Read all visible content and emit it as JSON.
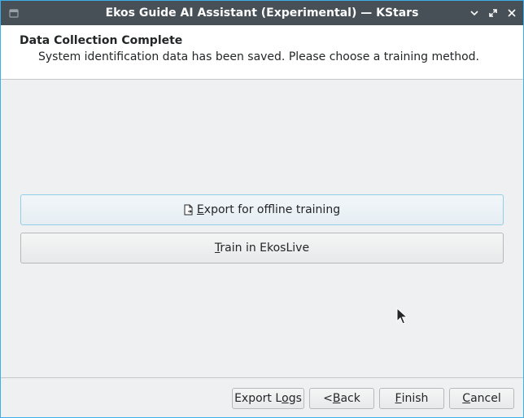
{
  "window": {
    "title": "Ekos Guide AI Assistant (Experimental) — KStars",
    "icons": {
      "app": "kstars-app-icon",
      "minimize": "chevron-down-icon",
      "maximize": "maximize-icon",
      "close": "close-icon"
    }
  },
  "header": {
    "title": "Data Collection Complete",
    "subtitle": "System identification data has been saved. Please choose a training method."
  },
  "options": [
    {
      "mnemonic": "E",
      "rest": "xport for offline training",
      "icon": "document-export-icon",
      "focused": true
    },
    {
      "mnemonic": "T",
      "rest": "rain in EkosLive",
      "focused": false
    }
  ],
  "buttons": {
    "export_logs": {
      "before": "Export L",
      "mnemonic": "o",
      "after": "gs"
    },
    "back": {
      "before": "< ",
      "mnemonic": "B",
      "after": "ack"
    },
    "finish": {
      "before": "",
      "mnemonic": "F",
      "after": "inish"
    },
    "cancel": {
      "before": "",
      "mnemonic": "C",
      "after": "ancel"
    }
  },
  "colors": {
    "titlebar": "#475057",
    "accent": "#3daee9",
    "window_bg": "#eff0f1",
    "header_bg": "#ffffff"
  }
}
